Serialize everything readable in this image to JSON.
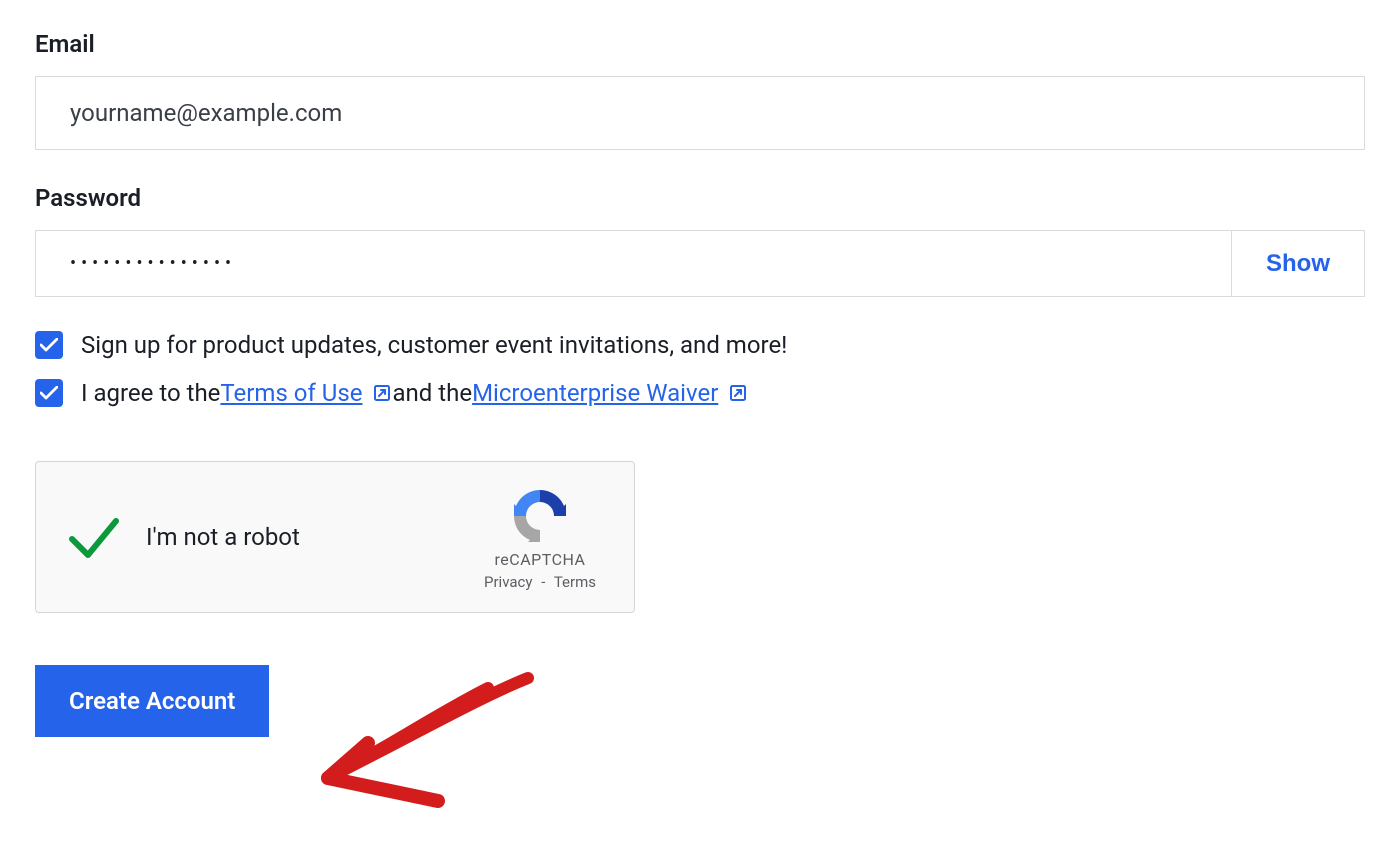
{
  "email": {
    "label": "Email",
    "placeholder": "yourname@example.com",
    "value": ""
  },
  "password": {
    "label": "Password",
    "masked_value": "•••••••••••••••",
    "show_button": "Show"
  },
  "checkboxes": {
    "updates": {
      "checked": true,
      "label": "Sign up for product updates, customer event invitations, and more!"
    },
    "terms": {
      "checked": true,
      "prefix": "I agree to the ",
      "terms_link": "Terms of Use",
      "middle": " and the ",
      "waiver_link": "Microenterprise Waiver"
    }
  },
  "recaptcha": {
    "verified": true,
    "label": "I'm not a robot",
    "brand": "reCAPTCHA",
    "privacy": "Privacy",
    "separator": "-",
    "terms": "Terms"
  },
  "submit": {
    "label": "Create Account"
  }
}
